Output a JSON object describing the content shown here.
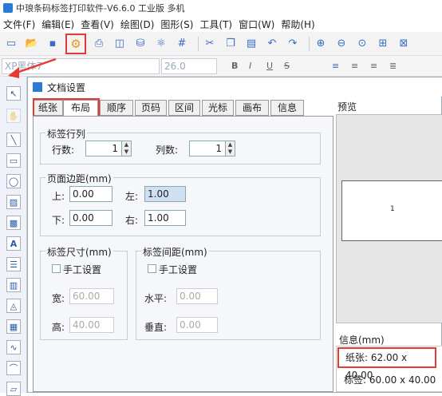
{
  "window": {
    "title": "中琅条码标签打印软件-V6.6.0 工业版 多机"
  },
  "menu": [
    "文件(F)",
    "编辑(E)",
    "查看(V)",
    "绘图(D)",
    "图形(S)",
    "工具(T)",
    "窗口(W)",
    "帮助(H)"
  ],
  "fontbar": {
    "font": "XP黑体7",
    "size": "26.0",
    "bold": "B",
    "italic": "I",
    "underline": "U",
    "strike": "S"
  },
  "dialog": {
    "title": "文档设置",
    "tabs": [
      "纸张",
      "布局",
      "顺序",
      "页码",
      "区间",
      "光标",
      "画布",
      "信息"
    ],
    "rows_cols": {
      "title": "标签行列",
      "rows_label": "行数:",
      "rows": "1",
      "cols_label": "列数:",
      "cols": "1"
    },
    "margins": {
      "title": "页面边距(mm)",
      "top_label": "上:",
      "top": "0.00",
      "left_label": "左:",
      "left": "1.00",
      "bottom_label": "下:",
      "bottom": "0.00",
      "right_label": "右:",
      "right": "1.00"
    },
    "size": {
      "title": "标签尺寸(mm)",
      "manual": "手工设置",
      "width_label": "宽:",
      "width": "60.00",
      "height_label": "高:",
      "height": "40.00"
    },
    "gap": {
      "title": "标签间距(mm)",
      "manual": "手工设置",
      "h_label": "水平:",
      "h": "0.00",
      "v_label": "垂直:",
      "v": "0.00"
    },
    "preview": {
      "title": "预览",
      "num": "1"
    },
    "info": {
      "title": "信息(mm)",
      "paper": "纸张: 62.00 x 40.00",
      "label": "标签: 60.00 x 40.00"
    }
  },
  "colors": {
    "highlight": "#e53935",
    "accent": "#2b7bd6"
  }
}
